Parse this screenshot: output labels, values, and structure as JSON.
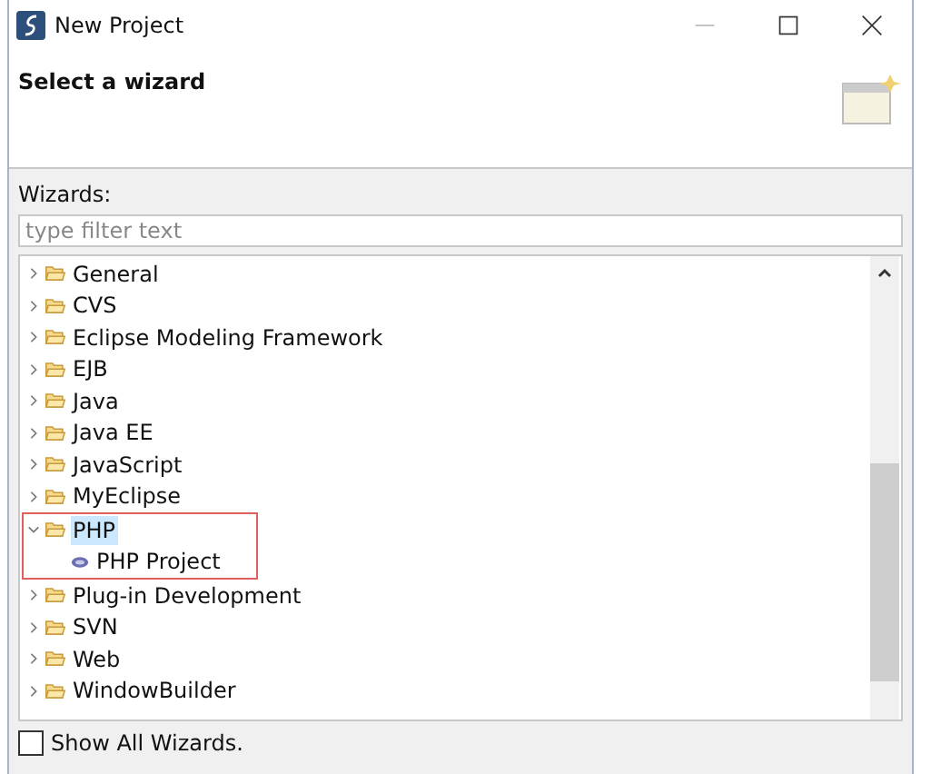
{
  "window": {
    "title": "New Project"
  },
  "header": {
    "title": "Select a wizard"
  },
  "wizards": {
    "label": "Wizards:",
    "filter": {
      "placeholder": "type filter text"
    },
    "tree": [
      {
        "label": "General",
        "expanded": false,
        "selected": false
      },
      {
        "label": "CVS",
        "expanded": false,
        "selected": false
      },
      {
        "label": "Eclipse Modeling Framework",
        "expanded": false,
        "selected": false
      },
      {
        "label": "EJB",
        "expanded": false,
        "selected": false
      },
      {
        "label": "Java",
        "expanded": false,
        "selected": false
      },
      {
        "label": "Java EE",
        "expanded": false,
        "selected": false
      },
      {
        "label": "JavaScript",
        "expanded": false,
        "selected": false
      },
      {
        "label": "MyEclipse",
        "expanded": false,
        "selected": false
      },
      {
        "label": "PHP",
        "expanded": true,
        "selected": true,
        "highlighted": true,
        "children": [
          {
            "label": "PHP Project",
            "selected": false
          }
        ]
      },
      {
        "label": "Plug-in Development",
        "expanded": false,
        "selected": false
      },
      {
        "label": "SVN",
        "expanded": false,
        "selected": false
      },
      {
        "label": "Web",
        "expanded": false,
        "selected": false
      },
      {
        "label": "WindowBuilder",
        "expanded": false,
        "selected": false
      }
    ]
  },
  "show_all": {
    "label": "Show All Wizards.",
    "checked": false
  }
}
